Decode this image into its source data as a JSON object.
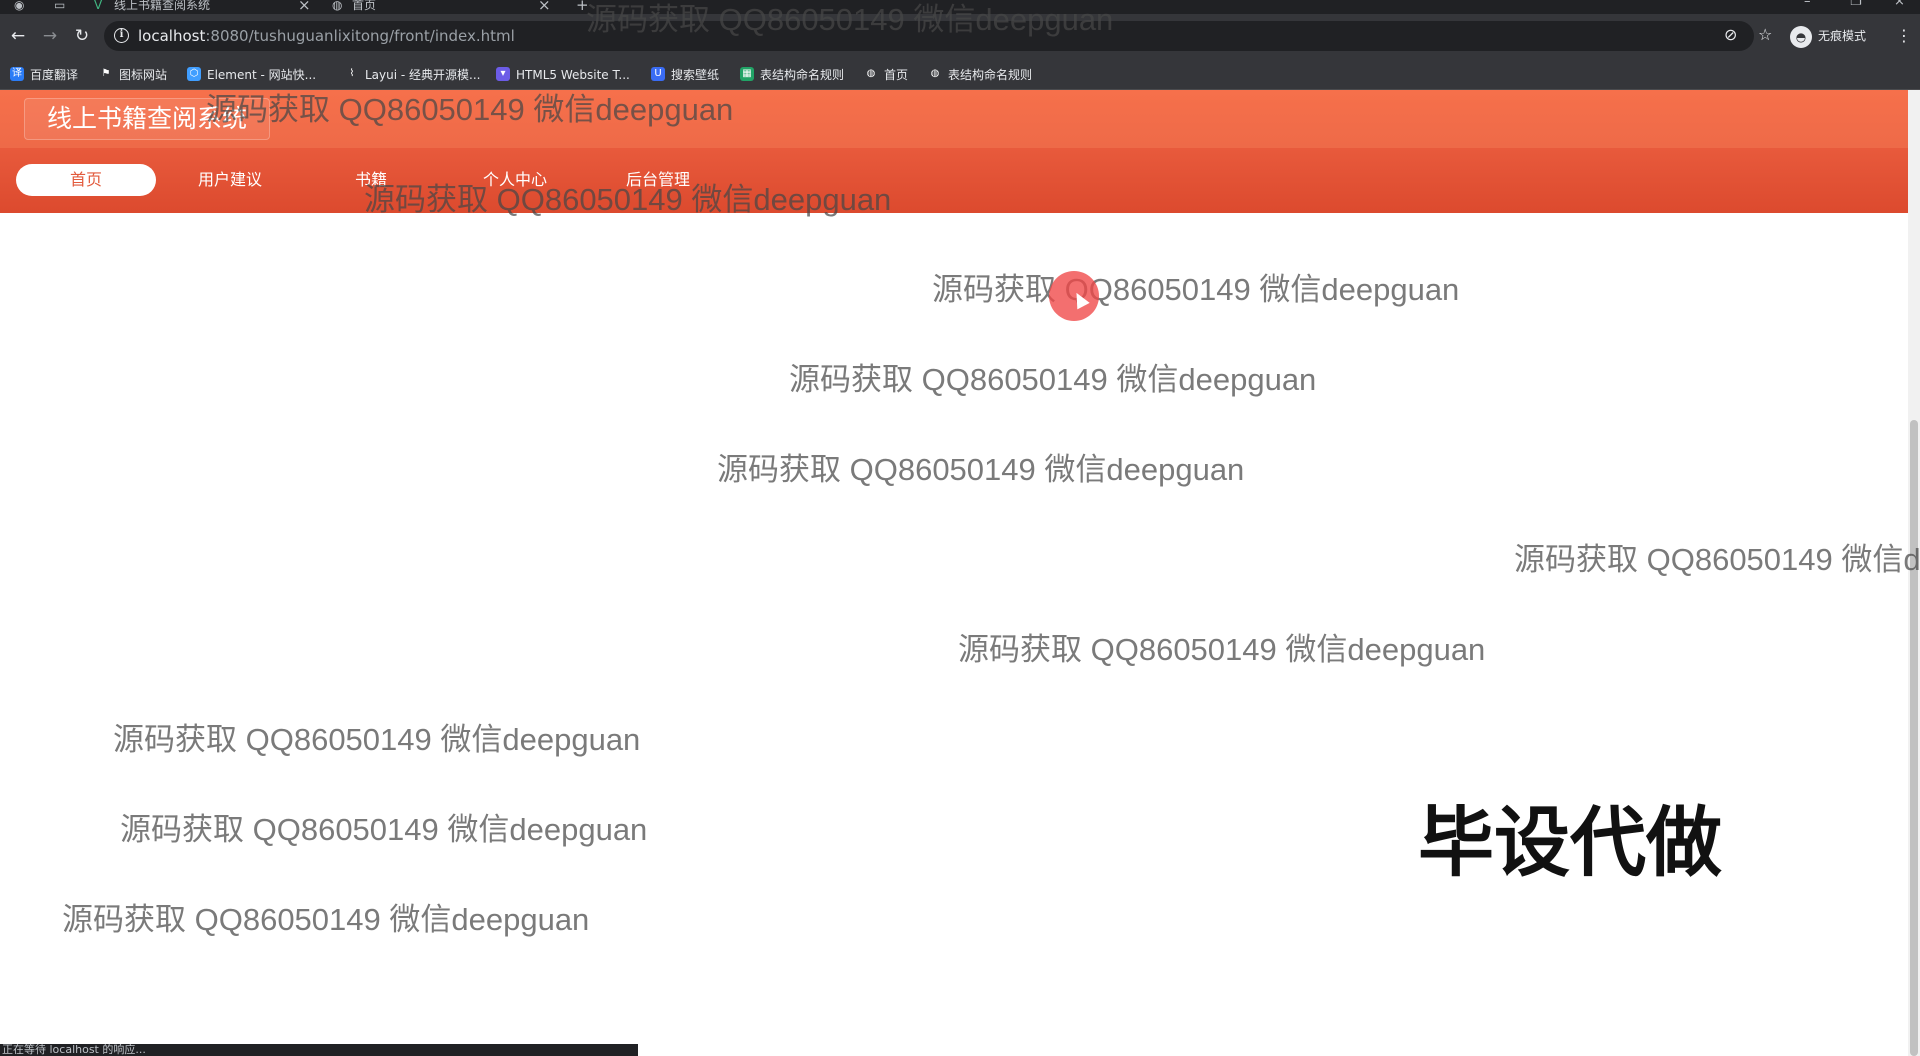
{
  "browser": {
    "tabs": [
      {
        "title": "线上书籍查阅系统",
        "icon": "vue-logo-icon"
      },
      {
        "title": "首页",
        "icon": "globe-icon"
      }
    ],
    "url_host": "localhost",
    "url_path": ":8080/tushuguanlixitong/front/index.html",
    "incognito_label": "无痕模式",
    "bookmarks": [
      {
        "label": "百度翻译",
        "icon": "baidu-translate-icon",
        "color": "#2b7cf6"
      },
      {
        "label": "图标网站",
        "icon": "flag-icon",
        "color": "#ffffff"
      },
      {
        "label": "Element - 网站快...",
        "icon": "element-icon",
        "color": "#409eff"
      },
      {
        "label": "Layui - 经典开源模...",
        "icon": "layui-icon",
        "color": "#a0a0a0"
      },
      {
        "label": "HTML5 Website T...",
        "icon": "html5-icon",
        "color": "#6c5ce7"
      },
      {
        "label": "搜索壁纸",
        "icon": "wallpaper-icon",
        "color": "#3a6cf4"
      },
      {
        "label": "表结构命名规则",
        "icon": "sheet-icon",
        "color": "#21a366"
      },
      {
        "label": "首页",
        "icon": "globe-icon",
        "color": "#ffffff"
      },
      {
        "label": "表结构命名规则",
        "icon": "globe-icon",
        "color": "#ffffff"
      }
    ],
    "status_text": "正在等待 localhost 的响应..."
  },
  "site": {
    "title": "线上书籍查阅系统",
    "nav": [
      "首页",
      "用户建议",
      "书籍",
      "个人中心",
      "后台管理"
    ],
    "active_nav": "首页",
    "header_color": "#f26d4b",
    "nav_color": "#e2543a"
  },
  "overlay": {
    "watermark_text": "源码获取 QQ86050149 微信deepguan",
    "watermark_text_cut": "源码获取 QQ86050149 微信d",
    "promo_text": "毕设代做"
  }
}
